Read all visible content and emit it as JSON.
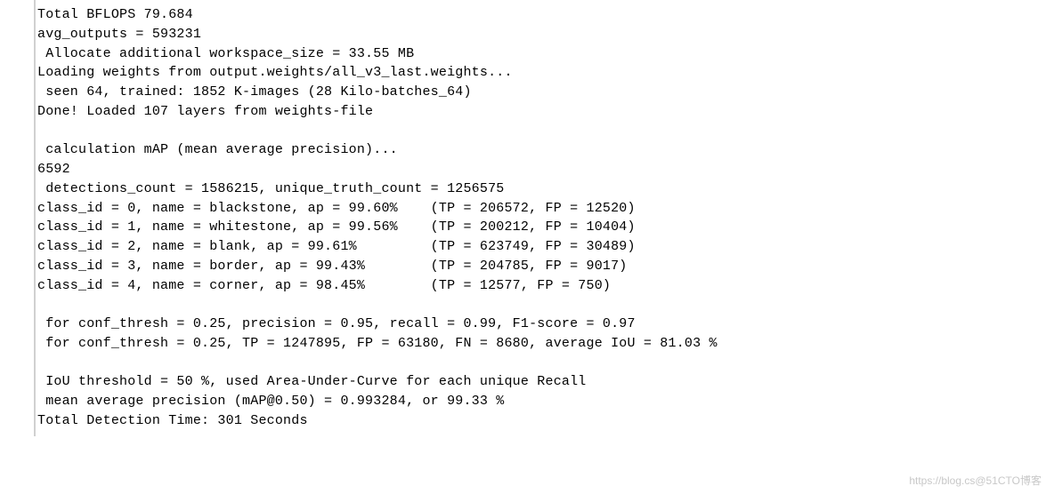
{
  "terminal": {
    "lines": [
      "Total BFLOPS 79.684",
      "avg_outputs = 593231",
      " Allocate additional workspace_size = 33.55 MB",
      "Loading weights from output.weights/all_v3_last.weights...",
      " seen 64, trained: 1852 K-images (28 Kilo-batches_64)",
      "Done! Loaded 107 layers from weights-file",
      "",
      " calculation mAP (mean average precision)...",
      "6592",
      " detections_count = 1586215, unique_truth_count = 1256575",
      "class_id = 0, name = blackstone, ap = 99.60%    (TP = 206572, FP = 12520)",
      "class_id = 1, name = whitestone, ap = 99.56%    (TP = 200212, FP = 10404)",
      "class_id = 2, name = blank, ap = 99.61%         (TP = 623749, FP = 30489)",
      "class_id = 3, name = border, ap = 99.43%        (TP = 204785, FP = 9017)",
      "class_id = 4, name = corner, ap = 98.45%        (TP = 12577, FP = 750)",
      "",
      " for conf_thresh = 0.25, precision = 0.95, recall = 0.99, F1-score = 0.97",
      " for conf_thresh = 0.25, TP = 1247895, FP = 63180, FN = 8680, average IoU = 81.03 %",
      "",
      " IoU threshold = 50 %, used Area-Under-Curve for each unique Recall",
      " mean average precision (mAP@0.50) = 0.993284, or 99.33 %",
      "Total Detection Time: 301 Seconds"
    ]
  },
  "summary": {
    "total_bflops": 79.684,
    "avg_outputs": 593231,
    "workspace_size_mb": 33.55,
    "weights_file": "output.weights/all_v3_last.weights",
    "seen": 64,
    "trained_k_images": 1852,
    "kilo_batches_64": 28,
    "layers_loaded": 107,
    "count_value": 6592,
    "detections_count": 1586215,
    "unique_truth_count": 1256575,
    "classes": [
      {
        "class_id": 0,
        "name": "blackstone",
        "ap_percent": 99.6,
        "TP": 206572,
        "FP": 12520
      },
      {
        "class_id": 1,
        "name": "whitestone",
        "ap_percent": 99.56,
        "TP": 200212,
        "FP": 10404
      },
      {
        "class_id": 2,
        "name": "blank",
        "ap_percent": 99.61,
        "TP": 623749,
        "FP": 30489
      },
      {
        "class_id": 3,
        "name": "border",
        "ap_percent": 99.43,
        "TP": 204785,
        "FP": 9017
      },
      {
        "class_id": 4,
        "name": "corner",
        "ap_percent": 98.45,
        "TP": 12577,
        "FP": 750
      }
    ],
    "conf_thresh": 0.25,
    "precision": 0.95,
    "recall": 0.99,
    "f1_score": 0.97,
    "TP_total": 1247895,
    "FP_total": 63180,
    "FN_total": 8680,
    "average_iou_percent": 81.03,
    "iou_threshold_percent": 50,
    "map_at_050": 0.993284,
    "map_at_050_percent": 99.33,
    "total_detection_time_seconds": 301
  },
  "watermark": "https://blog.cs@51CTO博客"
}
